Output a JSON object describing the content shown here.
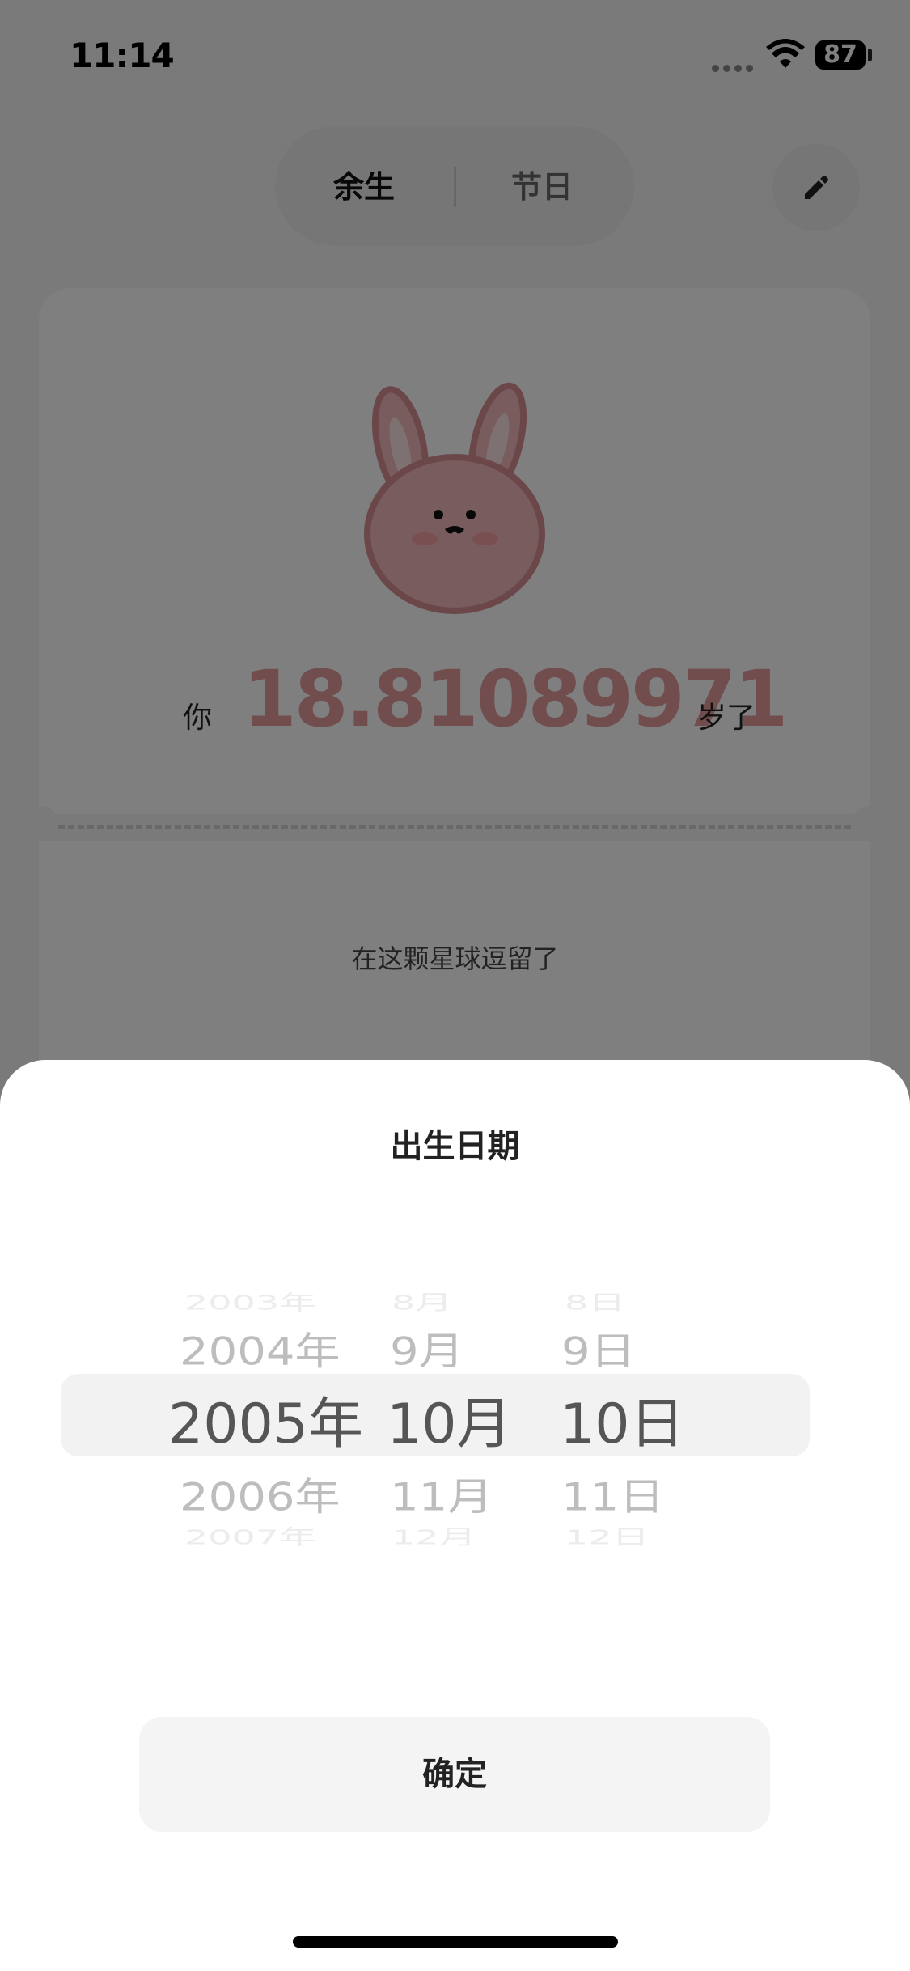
{
  "status_bar": {
    "time": "11:14",
    "battery": "87"
  },
  "tabs": [
    {
      "label": "余生"
    },
    {
      "label": "节日"
    }
  ],
  "card": {
    "age_prefix": "你",
    "age_value": "18.81089971",
    "age_suffix": "岁了",
    "stay_text": "在这颗星球逗留了"
  },
  "sheet": {
    "title": "出生日期",
    "confirm_label": "确定",
    "picker": {
      "years": [
        "2003年",
        "2004年",
        "2005年",
        "2006年",
        "2007年"
      ],
      "months": [
        "8月",
        "9月",
        "10月",
        "11月",
        "12月"
      ],
      "days": [
        "8日",
        "9日",
        "10日",
        "11日",
        "12日"
      ],
      "selected": {
        "year": "2005年",
        "month": "10月",
        "day": "10日"
      }
    }
  },
  "colors": {
    "age_number": "#e39a9c",
    "overlay": "rgba(0,0,0,0.5)"
  }
}
